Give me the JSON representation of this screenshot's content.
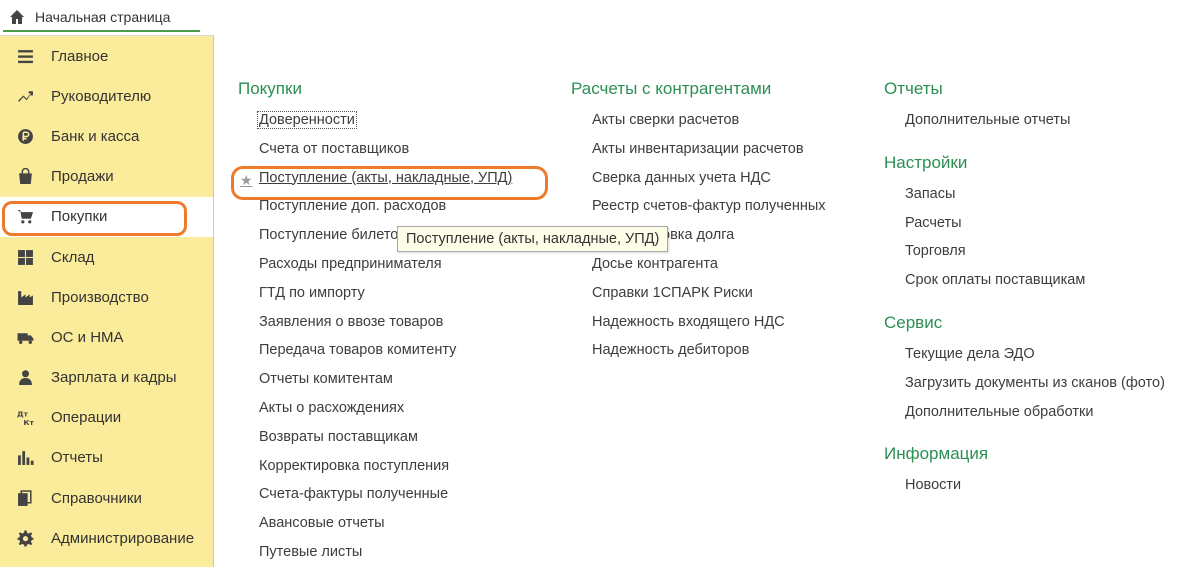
{
  "home_tab": {
    "label": "Начальная страница"
  },
  "sidebar": {
    "items": [
      {
        "label": "Главное",
        "icon": "menu-icon"
      },
      {
        "label": "Руководителю",
        "icon": "trend-icon"
      },
      {
        "label": "Банк и касса",
        "icon": "ruble-icon"
      },
      {
        "label": "Продажи",
        "icon": "bag-icon"
      },
      {
        "label": "Покупки",
        "icon": "cart-icon",
        "active": true
      },
      {
        "label": "Склад",
        "icon": "grid-icon"
      },
      {
        "label": "Производство",
        "icon": "factory-icon"
      },
      {
        "label": "ОС и НМА",
        "icon": "truck-icon"
      },
      {
        "label": "Зарплата и кадры",
        "icon": "person-icon"
      },
      {
        "label": "Операции",
        "icon": "dt-kt-icon"
      },
      {
        "label": "Отчеты",
        "icon": "bar-chart-icon"
      },
      {
        "label": "Справочники",
        "icon": "books-icon"
      },
      {
        "label": "Администрирование",
        "icon": "gear-icon"
      }
    ],
    "highlight_color": "#ee7b2c",
    "background": "#fbec9b"
  },
  "columns": [
    {
      "sections": [
        {
          "title": "Покупки",
          "links": [
            "Доверенности",
            "Счета от поставщиков",
            "Поступление (акты, накладные, УПД)",
            "Поступление доп. расходов",
            "Поступление билетов",
            "Расходы предпринимателя",
            "ГТД по импорту",
            "Заявления о ввозе товаров",
            "Передача товаров комитенту",
            "Отчеты комитентам",
            "Акты о расхождениях",
            "Возвраты поставщикам",
            "Корректировка поступления",
            "Счета-фактуры полученные",
            "Авансовые отчеты",
            "Путевые листы"
          ]
        }
      ]
    },
    {
      "sections": [
        {
          "title": "Расчеты с контрагентами",
          "links": [
            "Акты сверки расчетов",
            "Акты инвентаризации расчетов",
            "Сверка данных учета НДС",
            "Реестр счетов-фактур полученных",
            "Корректировка долга",
            "Досье контрагента",
            "Справки 1СПАРК Риски",
            "Надежность входящего НДС",
            "Надежность дебиторов"
          ]
        }
      ]
    },
    {
      "sections": [
        {
          "title": "Отчеты",
          "links": [
            "Дополнительные отчеты"
          ]
        },
        {
          "title": "Настройки",
          "links": [
            "Запасы",
            "Расчеты",
            "Торговля",
            "Срок оплаты поставщикам"
          ]
        },
        {
          "title": "Сервис",
          "links": [
            "Текущие дела ЭДО",
            "Загрузить документы из сканов (фото)",
            "Дополнительные обработки"
          ]
        },
        {
          "title": "Информация",
          "links": [
            "Новости"
          ]
        }
      ]
    }
  ],
  "tooltip": {
    "text": "Поступление (акты, накладные, УПД)"
  },
  "accent_green": "#2b8f53"
}
